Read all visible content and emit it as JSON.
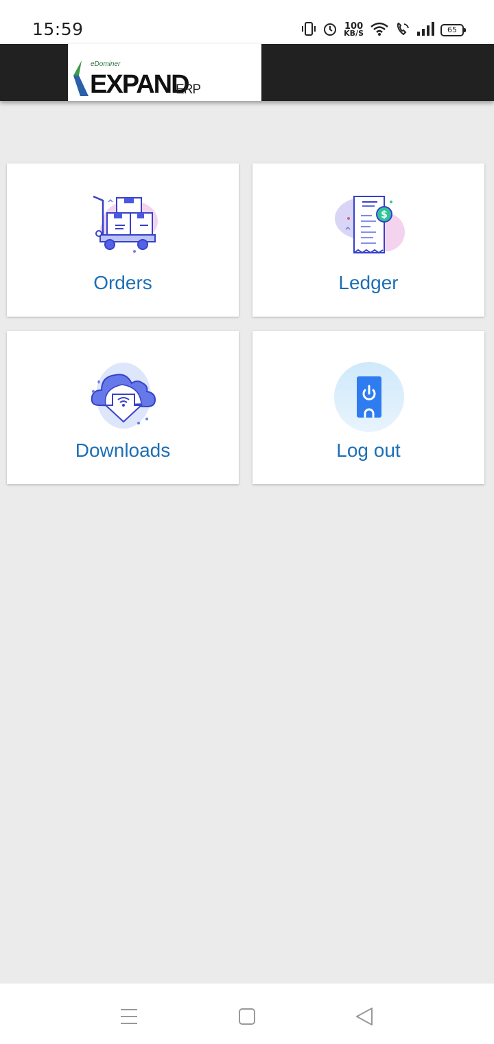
{
  "status_bar": {
    "time": "15:59",
    "net_speed_value": "100",
    "net_speed_unit": "KB/S",
    "battery_level": "65",
    "icons": [
      "vibrate-icon",
      "alarm-icon",
      "wifi-icon",
      "wifi-call-icon",
      "signal-icon",
      "battery-icon"
    ]
  },
  "header": {
    "logo_small": "eDominer",
    "logo_main": "EXPAND",
    "logo_suffix": "ERP"
  },
  "tiles": [
    {
      "label": "Orders",
      "icon": "cart-boxes-icon"
    },
    {
      "label": "Ledger",
      "icon": "receipt-icon"
    },
    {
      "label": "Downloads",
      "icon": "cloud-download-icon"
    },
    {
      "label": "Log out",
      "icon": "power-phone-icon"
    }
  ],
  "nav_bar": {
    "icons": [
      "menu-icon",
      "home-icon",
      "back-icon"
    ]
  },
  "colors": {
    "accent_text": "#1c6fb5",
    "app_bar": "#212121",
    "background": "#ebebeb"
  }
}
